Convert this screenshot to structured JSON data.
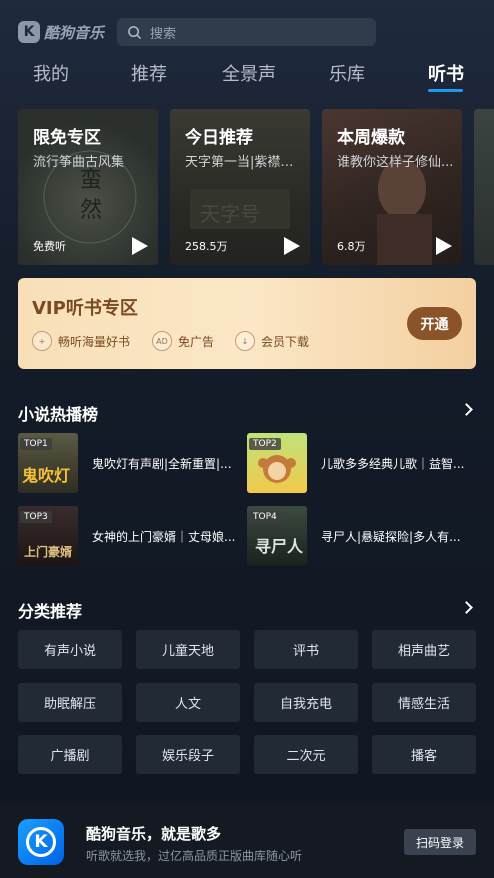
{
  "app": {
    "logo_text": "酷狗音乐",
    "logo_mark": "K"
  },
  "search": {
    "placeholder": "搜索"
  },
  "tabs": [
    {
      "label": "我的"
    },
    {
      "label": "推荐"
    },
    {
      "label": "全景声"
    },
    {
      "label": "乐库"
    },
    {
      "label": "听书",
      "active": true
    }
  ],
  "cards": [
    {
      "title": "限免专区",
      "subtitle": "流行筝曲古风集",
      "stat": "免费听"
    },
    {
      "title": "今日推荐",
      "subtitle": "天字第一当|紫襟领...",
      "stat": "258.5万"
    },
    {
      "title": "本周爆款",
      "subtitle": "谁教你这样子修仙...",
      "stat": "6.8万"
    }
  ],
  "vip": {
    "title": "VIP听书专区",
    "features": [
      {
        "label": "畅听海量好书",
        "icon": "book-icon"
      },
      {
        "label": "免广告",
        "icon": "ad-icon"
      },
      {
        "label": "会员下载",
        "icon": "download-icon"
      }
    ],
    "button": "开通"
  },
  "rank": {
    "title": "小说热播榜",
    "items": [
      {
        "badge": "TOP1",
        "title": "鬼吹灯有声剧|全新重置|..."
      },
      {
        "badge": "TOP2",
        "title": "儿歌多多经典儿歌｜益智..."
      },
      {
        "badge": "TOP3",
        "title": "女神的上门豪婿｜丈母娘..."
      },
      {
        "badge": "TOP4",
        "title": "寻尸人|悬疑探险|多人有..."
      }
    ]
  },
  "categories": {
    "title": "分类推荐",
    "items": [
      "有声小说",
      "儿童天地",
      "评书",
      "相声曲艺",
      "助眠解压",
      "人文",
      "自我充电",
      "情感生活",
      "广播剧",
      "娱乐段子",
      "二次元",
      "播客"
    ]
  },
  "footer": {
    "title": "酷狗音乐，就是歌多",
    "subtitle": "听歌就选我，过亿高品质正版曲库随心听",
    "button": "扫码登录",
    "app_mark": "K"
  }
}
